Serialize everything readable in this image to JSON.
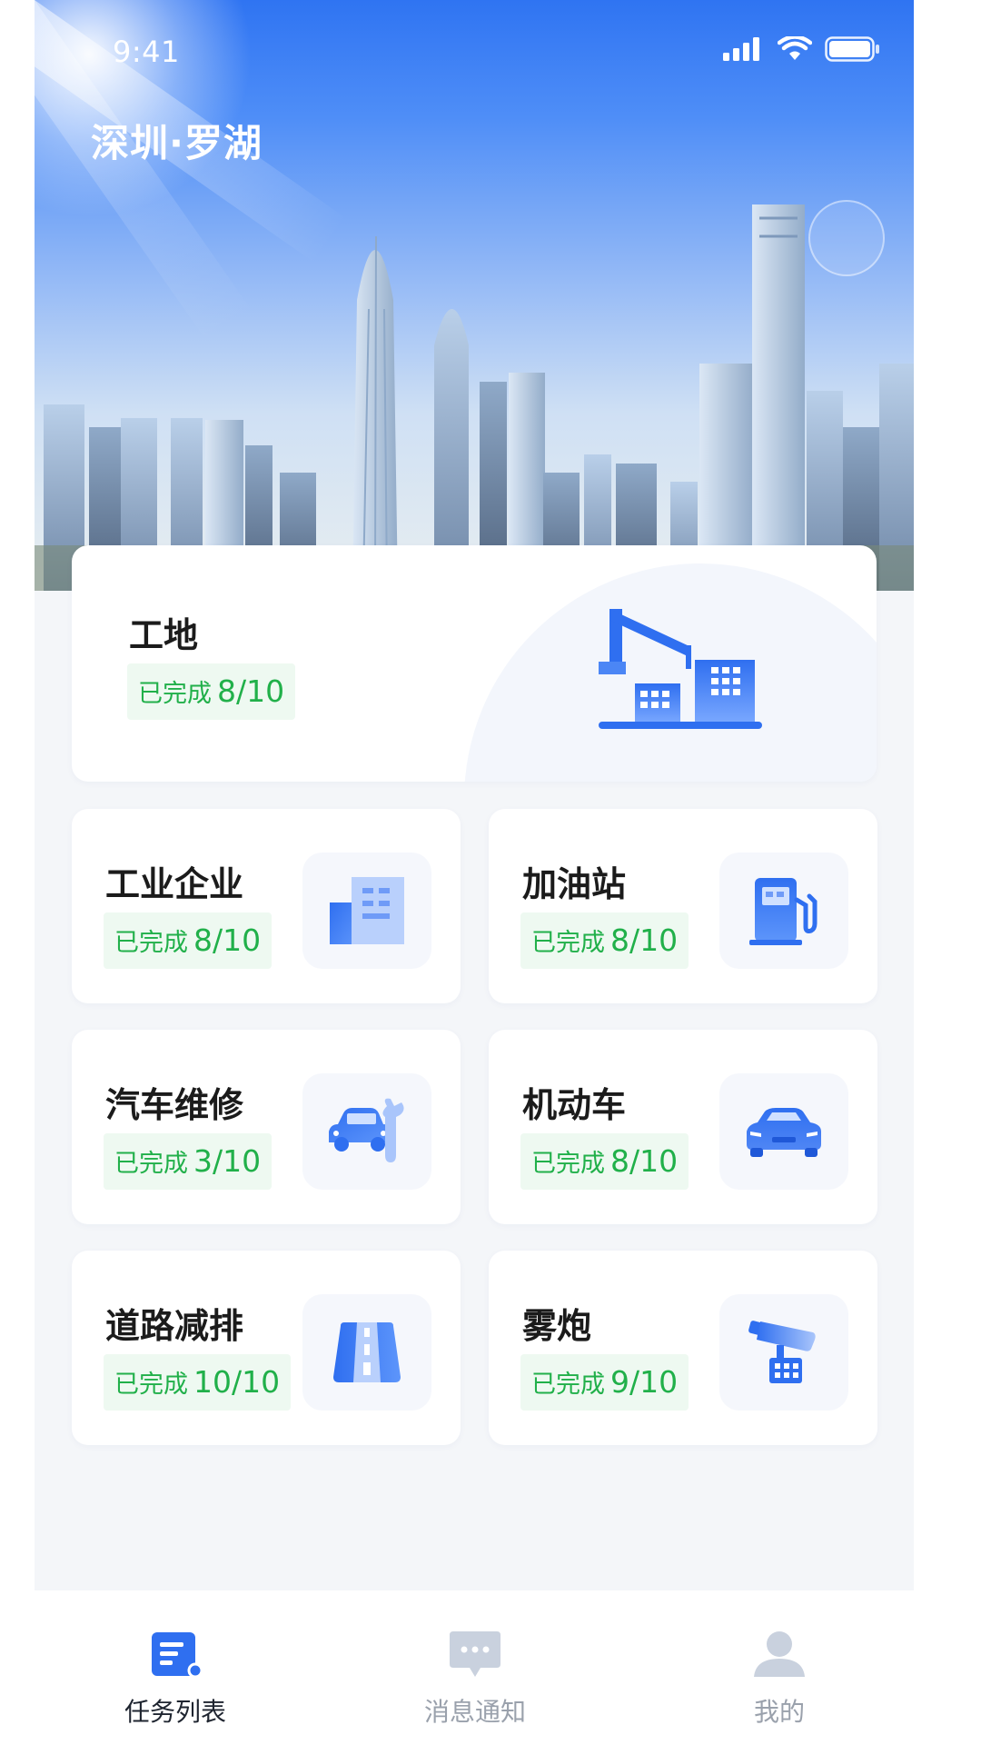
{
  "status_bar": {
    "time": "9:41"
  },
  "header": {
    "location": "深圳·罗湖"
  },
  "colors": {
    "accent": "#2f6ff0",
    "badge_text": "#21b04a",
    "badge_bg": "#eef9f1",
    "tab_inactive": "#9aa1ac"
  },
  "categories": [
    {
      "name": "工地",
      "status_label": "已完成",
      "progress": "8/10",
      "icon": "construction-site-icon"
    },
    {
      "name": "工业企业",
      "status_label": "已完成",
      "progress": "8/10",
      "icon": "industrial-building-icon"
    },
    {
      "name": "加油站",
      "status_label": "已完成",
      "progress": "8/10",
      "icon": "gas-pump-icon"
    },
    {
      "name": "汽车维修",
      "status_label": "已完成",
      "progress": "3/10",
      "icon": "car-repair-icon"
    },
    {
      "name": "机动车",
      "status_label": "已完成",
      "progress": "8/10",
      "icon": "car-icon"
    },
    {
      "name": "道路减排",
      "status_label": "已完成",
      "progress": "10/10",
      "icon": "road-icon"
    },
    {
      "name": "雾炮",
      "status_label": "已完成",
      "progress": "9/10",
      "icon": "fog-cannon-icon"
    }
  ],
  "tabbar": {
    "items": [
      {
        "label": "任务列表",
        "icon": "task-list-icon",
        "active": true
      },
      {
        "label": "消息通知",
        "icon": "message-icon",
        "active": false
      },
      {
        "label": "我的",
        "icon": "user-icon",
        "active": false
      }
    ]
  }
}
